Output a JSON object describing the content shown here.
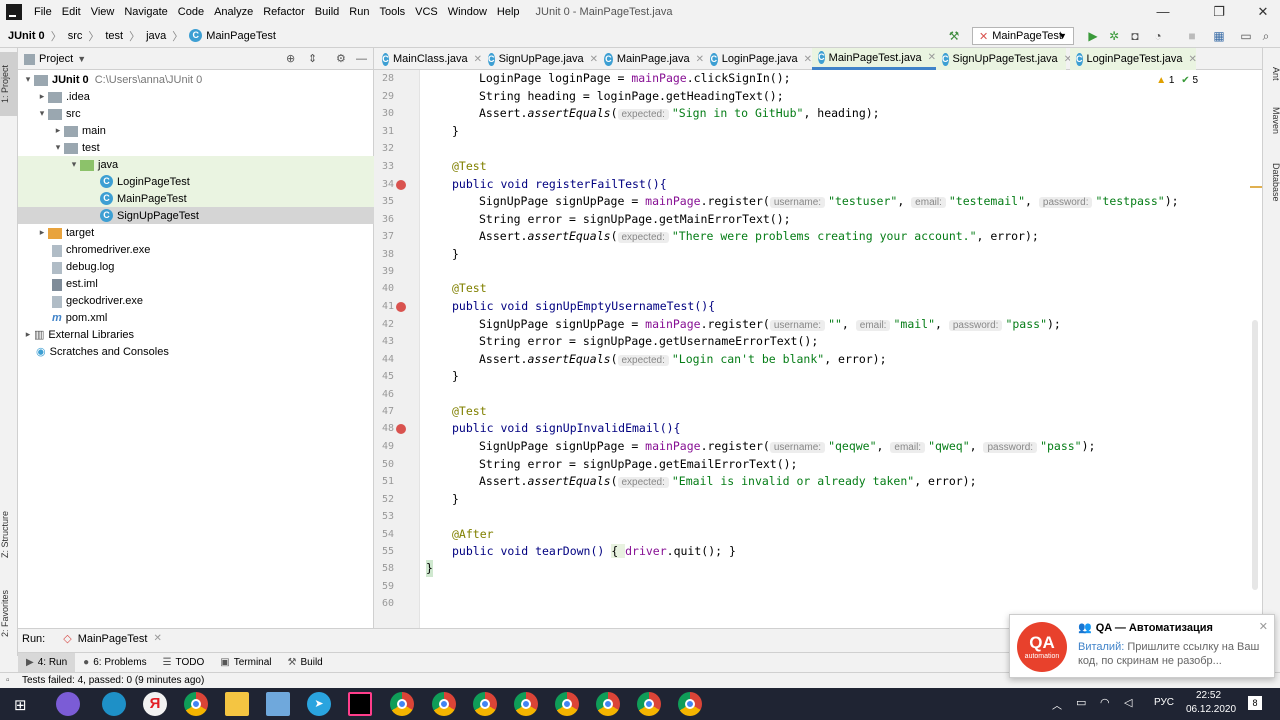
{
  "menubar": {
    "items": [
      "File",
      "Edit",
      "View",
      "Navigate",
      "Code",
      "Analyze",
      "Refactor",
      "Build",
      "Run",
      "Tools",
      "VCS",
      "Window",
      "Help"
    ],
    "title": "JUnit 0 - MainPageTest.java"
  },
  "navbar": {
    "crumbs": [
      "JUnit 0",
      "src",
      "test",
      "java",
      "MainPageTest"
    ],
    "run_config": "MainPageTest"
  },
  "project": {
    "header": "Project",
    "tree": [
      {
        "label": "JUnit 0",
        "extra": "C:\\Users\\anna\\JUnit 0"
      },
      {
        "label": ".idea"
      },
      {
        "label": "src"
      },
      {
        "label": "main"
      },
      {
        "label": "test"
      },
      {
        "label": "java"
      },
      {
        "label": "LoginPageTest"
      },
      {
        "label": "MainPageTest"
      },
      {
        "label": "SignUpPageTest"
      },
      {
        "label": "target"
      },
      {
        "label": "chromedriver.exe"
      },
      {
        "label": "debug.log"
      },
      {
        "label": "est.iml"
      },
      {
        "label": "geckodriver.exe"
      },
      {
        "label": "pom.xml"
      },
      {
        "label": "External Libraries"
      },
      {
        "label": "Scratches and Consoles"
      }
    ]
  },
  "left_tools": {
    "project": "1: Project",
    "structure": "Z: Structure",
    "favorites": "2: Favorites"
  },
  "right_tools": {
    "ant": "Ant",
    "maven": "Maven",
    "database": "Database"
  },
  "tabs": [
    "MainClass.java",
    "SignUpPage.java",
    "MainPage.java",
    "LoginPage.java",
    "MainPageTest.java",
    "SignUpPageTest.java",
    "LoginPageTest.java"
  ],
  "inspections": {
    "warnings": "1",
    "ok": "5"
  },
  "editor": {
    "line_numbers": [
      "28",
      "29",
      "30",
      "31",
      "32",
      "33",
      "34",
      "35",
      "36",
      "37",
      "38",
      "39",
      "40",
      "41",
      "42",
      "43",
      "44",
      "45",
      "46",
      "47",
      "48",
      "49",
      "50",
      "51",
      "52",
      "53",
      "54",
      "55",
      "58",
      "59",
      "60"
    ],
    "code": {
      "l28": "LoginPage loginPage = ",
      "l28b": "mainPage",
      "l28c": ".clickSignIn();",
      "l29": "String heading = loginPage.getHeadingText();",
      "l30a": "Assert.",
      "l30b": "assertEquals",
      "l30c": "(",
      "l30hint": "expected:",
      "l30str": "\"Sign in to GitHub\"",
      "l30d": ", heading);",
      "l31": "}",
      "l33": "@Test",
      "l34": "public void registerFailTest(){",
      "l35a": "SignUpPage signUpPage = ",
      "l35b": "mainPage",
      "l35c": ".register(",
      "l35h1": "username:",
      "l35s1": "\"testuser\"",
      "l35h2": "email:",
      "l35s2": "\"testemail\"",
      "l35h3": "password:",
      "l35s3": "\"testpass\"",
      "l36": "String error = signUpPage.getMainErrorText();",
      "l37str": "\"There were problems creating your account.\"",
      "l37d": ", error);",
      "l38": "}",
      "l40": "@Test",
      "l41": "public void signUpEmptyUsernameTest(){",
      "l42s1": "\"\"",
      "l42s2": "\"mail\"",
      "l42s3": "\"pass\"",
      "l43": "String error = signUpPage.getUsernameErrorText();",
      "l44str": "\"Login can't be blank\"",
      "l45": "}",
      "l47": "@Test",
      "l48": "public void signUpInvalidEmail(){",
      "l49s1": "\"qeqwe\"",
      "l49s2": "\"qweq\"",
      "l49s3": "\"pass\"",
      "l50": "String error = signUpPage.getEmailErrorText();",
      "l51str": "\"Email is invalid or already taken\"",
      "l52": "}",
      "l54": "@After",
      "l55a": "public void tearDown() ",
      "l55b": "{ ",
      "l55c": "driver",
      "l55d": ".quit(); }",
      "l58": "}"
    }
  },
  "run": {
    "label": "Run:",
    "config": "MainPageTest"
  },
  "bottom_tools": [
    "4: Run",
    "6: Problems",
    "TODO",
    "Terminal",
    "Build"
  ],
  "status": "Tests failed: 4, passed: 0 (9 minutes ago)",
  "notification": {
    "logo_top": "QA",
    "logo_bottom": "automation",
    "title": "QA — Автоматизация",
    "author": "Виталий:",
    "message": "Пришлите ссылку на Ваш код, по скринам не разобр..."
  },
  "tray": {
    "lang": "РУС",
    "time": "22:52",
    "date": "06.12.2020",
    "badge": "8"
  },
  "colors": {
    "accent": "#4083c9",
    "string": "#067d17",
    "keyword": "#000080",
    "annotation": "#808000",
    "field": "#871094",
    "notif_logo": "#e8412c"
  }
}
